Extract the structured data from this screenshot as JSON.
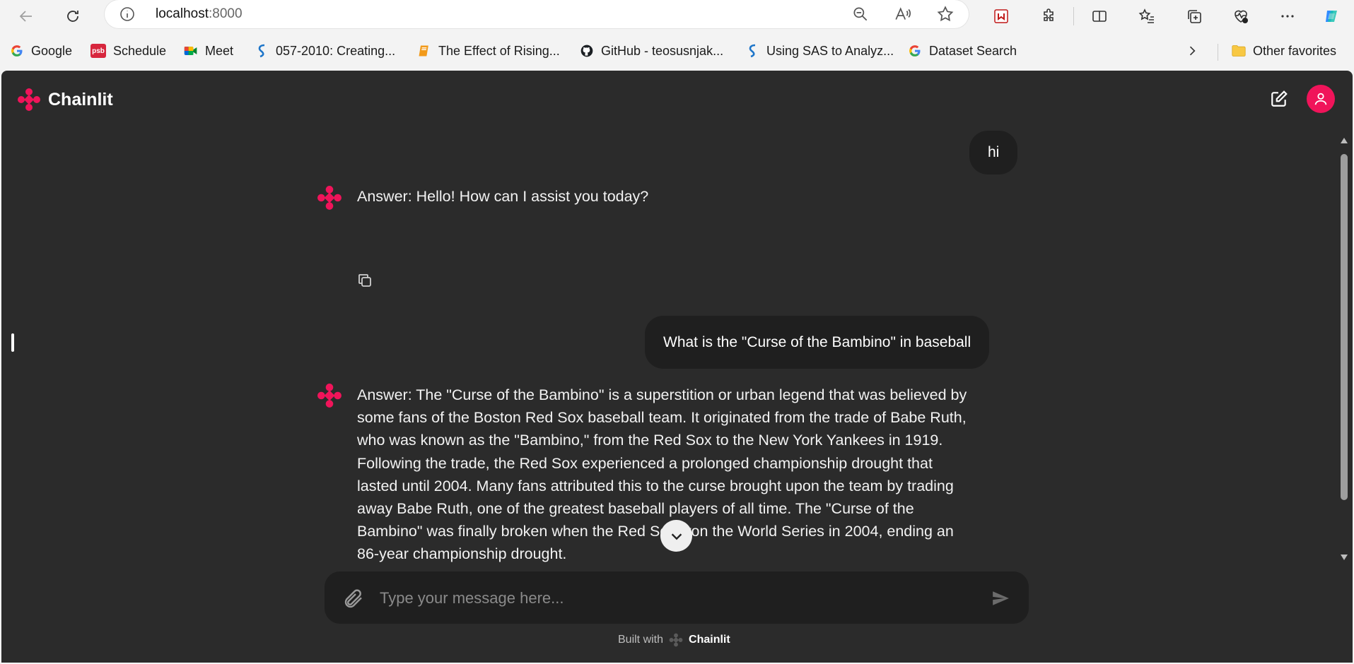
{
  "browser": {
    "address": {
      "host": "localhost",
      "port": ":8000"
    },
    "bookmarks": [
      {
        "label": "Google",
        "icon": "google-g-icon"
      },
      {
        "label": "Schedule",
        "icon": "psb-icon"
      },
      {
        "label": "Meet",
        "icon": "meet-icon"
      },
      {
        "label": "057-2010: Creating...",
        "icon": "s-logo-icon"
      },
      {
        "label": "The Effect of Rising...",
        "icon": "book-icon"
      },
      {
        "label": "GitHub - teosusnjak...",
        "icon": "github-icon"
      },
      {
        "label": "Using SAS to Analyz...",
        "icon": "s-logo-icon"
      },
      {
        "label": "Dataset Search",
        "icon": "google-g-icon"
      }
    ],
    "other_favorites": "Other favorites",
    "psb_badge": "psb"
  },
  "app": {
    "name": "Chainlit",
    "brand_color": "#f0145a",
    "messages": [
      {
        "role": "user",
        "text": "hi"
      },
      {
        "role": "assistant",
        "lines": [
          "Answer: Hello! How can I assist you today?"
        ]
      },
      {
        "role": "user",
        "text": "What is the \"Curse of the Bambino\" in baseball"
      },
      {
        "role": "assistant",
        "lines": [
          "Answer: The \"Curse of the Bambino\" is a superstition or urban legend that was believed by",
          "some fans of the Boston Red Sox baseball team. It originated from the trade of Babe Ruth,",
          "who was known as the \"Bambino,\" from the Red Sox to the New York Yankees in 1919.",
          "Following the trade, the Red Sox experienced a prolonged championship drought that",
          "lasted until 2004. Many fans attributed this to the curse brought upon the team by trading",
          "away Babe Ruth, one of the greatest baseball players of all time. The \"Curse of the",
          "Bambino\" was finally broken when the Red Sox won the World Series in 2004, ending an",
          "86-year championship drought."
        ]
      }
    ],
    "composer": {
      "placeholder": "Type your message here..."
    },
    "footer": {
      "prefix": "Built with",
      "brand": "Chainlit"
    }
  }
}
